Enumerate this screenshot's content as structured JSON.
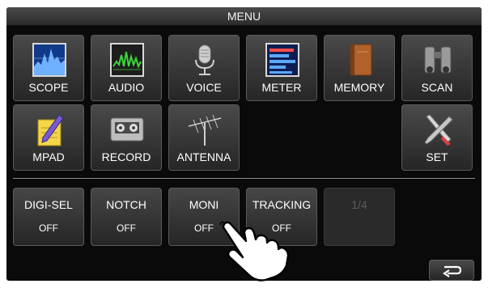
{
  "menu": {
    "title": "MENU"
  },
  "tiles": [
    {
      "label": "SCOPE",
      "icon": "scope-icon"
    },
    {
      "label": "AUDIO",
      "icon": "audio-icon"
    },
    {
      "label": "VOICE",
      "icon": "microphone-icon"
    },
    {
      "label": "METER",
      "icon": "meter-icon"
    },
    {
      "label": "MEMORY",
      "icon": "memory-book-icon"
    },
    {
      "label": "SCAN",
      "icon": "binoculars-icon"
    },
    {
      "label": "MPAD",
      "icon": "notepad-pencil-icon"
    },
    {
      "label": "RECORD",
      "icon": "cassette-icon"
    },
    {
      "label": "ANTENNA",
      "icon": "antenna-icon"
    },
    {
      "label": "SET",
      "icon": "tools-icon"
    }
  ],
  "functions": [
    {
      "label": "DIGI-SEL",
      "state": "OFF"
    },
    {
      "label": "NOTCH",
      "state": "OFF"
    },
    {
      "label": "MONI",
      "state": "OFF"
    },
    {
      "label": "TRACKING",
      "state": "OFF"
    }
  ],
  "page_indicator": "1/4",
  "icons": {
    "back": "return-arrow-icon",
    "pointer": "pointing-hand-icon"
  },
  "colors": {
    "background": "#0a0a0a",
    "button": "#3a3a3a",
    "text": "#ffffff"
  }
}
